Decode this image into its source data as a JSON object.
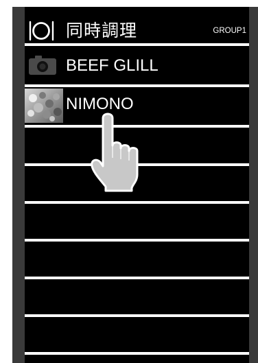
{
  "header": {
    "icon": "plate-fork-knife-icon",
    "title": "同時調理",
    "group": "GROUP1"
  },
  "list": {
    "items": [
      {
        "label": "BEEF GLILL",
        "icon": "camera-icon"
      },
      {
        "label": "NIMONO",
        "icon": "food-photo-thumbnail"
      }
    ],
    "empty_rows": 6
  },
  "pointer": {
    "icon": "pointing-hand-icon"
  },
  "colors": {
    "screen_bg": "#000000",
    "divider": "#ffffff",
    "frame": "#3a3a3a",
    "text": "#ffffff"
  }
}
